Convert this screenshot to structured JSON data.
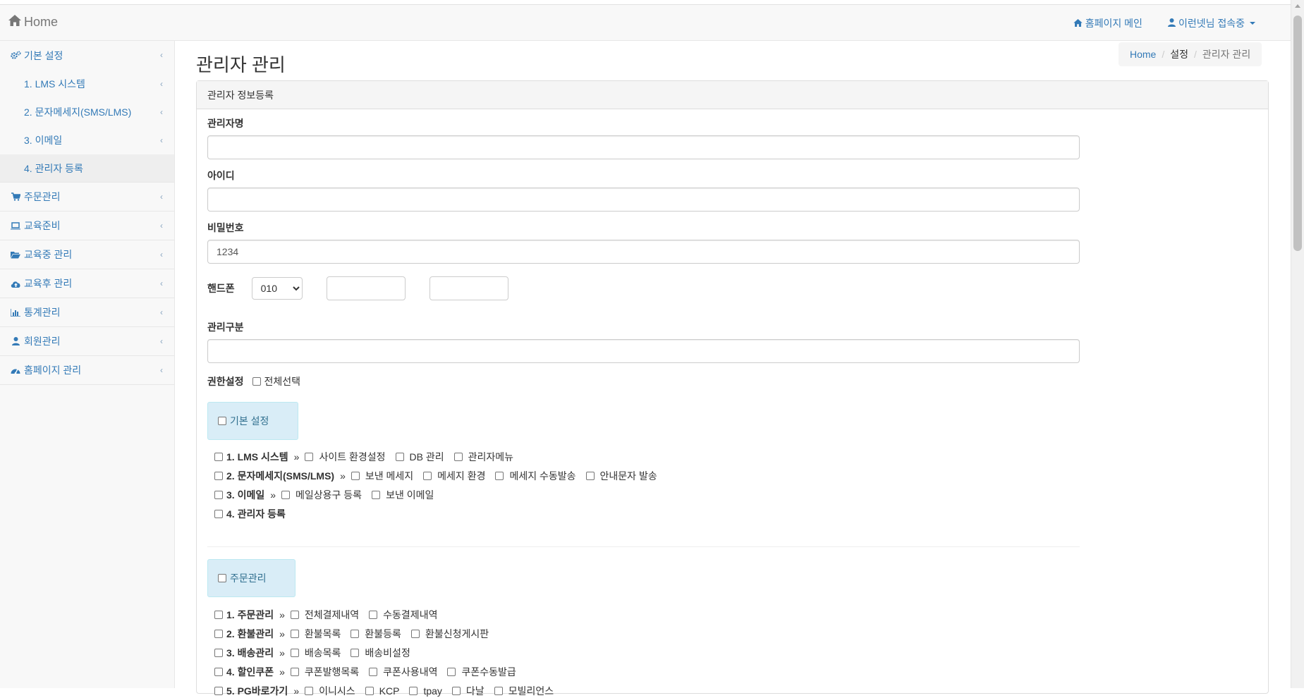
{
  "navbar": {
    "brand": "Home",
    "homepage_link": "홈페이지 메인",
    "user_link": "이런넷님 접속중"
  },
  "sidebar": {
    "items": [
      {
        "label": "기본 설정",
        "icon": "gears-icon"
      },
      {
        "label": "1. LMS 시스템"
      },
      {
        "label": "2. 문자메세지(SMS/LMS)"
      },
      {
        "label": "3. 이메일"
      },
      {
        "label": "4. 관리자 등록"
      },
      {
        "label": "주문관리",
        "icon": "cart-icon"
      },
      {
        "label": "교육준비",
        "icon": "laptop-icon"
      },
      {
        "label": "교육중 관리",
        "icon": "folder-open-icon"
      },
      {
        "label": "교육후 관리",
        "icon": "cloud-upload-icon"
      },
      {
        "label": "통계관리",
        "icon": "bar-chart-icon"
      },
      {
        "label": "회원관리",
        "icon": "user-icon"
      },
      {
        "label": "홈페이지 관리",
        "icon": "dashboard-icon"
      }
    ]
  },
  "main": {
    "title": "관리자 관리",
    "breadcrumb": [
      "Home",
      "설정",
      "관리자 관리"
    ]
  },
  "panel": {
    "heading": "관리자 정보등록",
    "fields": {
      "name_label": "관리자명",
      "name_value": "",
      "id_label": "아이디",
      "id_value": "",
      "password_label": "비밀번호",
      "password_value": "1234",
      "phone_label": "핸드폰",
      "phone_prefix": "010",
      "division_label": "관리구분",
      "division_value": ""
    },
    "auth": {
      "label": "권한설정",
      "select_all": "전체선택"
    },
    "groups": [
      {
        "title": "기본 설정",
        "rows": [
          {
            "label": "1. LMS 시스템",
            "options": [
              "사이트 환경설정",
              "DB 관리",
              "관리자메뉴"
            ]
          },
          {
            "label": "2. 문자메세지(SMS/LMS)",
            "options": [
              "보낸 메세지",
              "메세지 환경",
              "메세지 수동발송",
              "안내문자 발송"
            ]
          },
          {
            "label": "3. 이메일",
            "options": [
              "메일상용구 등록",
              "보낸 이메일"
            ]
          },
          {
            "label": "4. 관리자 등록",
            "options": []
          }
        ]
      },
      {
        "title": "주문관리",
        "rows": [
          {
            "label": "1. 주문관리",
            "options": [
              "전체결제내역",
              "수동결제내역"
            ]
          },
          {
            "label": "2. 환불관리",
            "options": [
              "환불목록",
              "환불등록",
              "환불신청게시판"
            ]
          },
          {
            "label": "3. 배송관리",
            "options": [
              "배송목록",
              "배송비설정"
            ]
          },
          {
            "label": "4. 할인쿠폰",
            "options": [
              "쿠폰발행목록",
              "쿠폰사용내역",
              "쿠폰수동발급"
            ]
          },
          {
            "label": "5. PG바로가기",
            "options": [
              "이니시스",
              "KCP",
              "tpay",
              "다날",
              "모빌리언스"
            ]
          }
        ]
      }
    ],
    "raquo": "»"
  }
}
